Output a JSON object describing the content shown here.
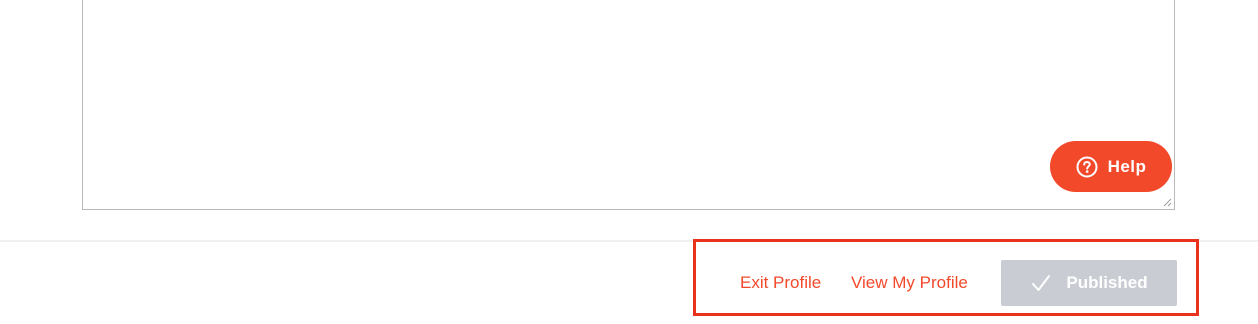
{
  "help_button": {
    "label": "Help",
    "icon": "question-circle-icon",
    "color": "#f2492b"
  },
  "footer": {
    "exit_profile_label": "Exit Profile",
    "view_profile_label": "View My Profile",
    "published_label": "Published",
    "published_icon": "check-icon",
    "link_color": "#f2492b",
    "published_bg": "#c9ccd3",
    "highlight_color": "#e8321c"
  }
}
